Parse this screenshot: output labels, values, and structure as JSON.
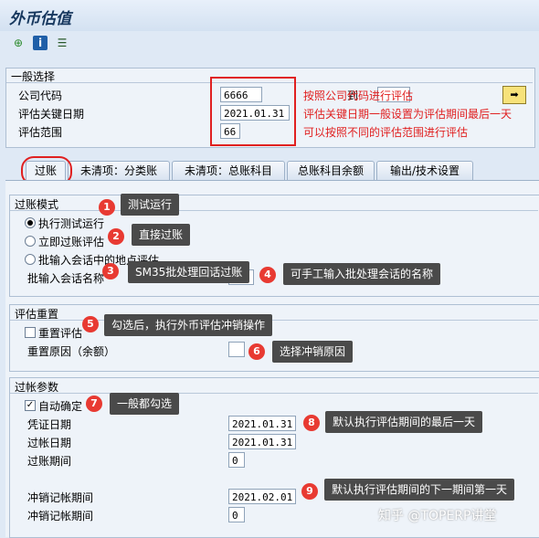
{
  "window": {
    "title": "外币估值"
  },
  "toolbar": {
    "execute_icon": "execute-icon",
    "info_icon": "info-icon",
    "variant_icon": "variant-icon"
  },
  "general": {
    "section_title": "一般选择",
    "company_code_label": "公司代码",
    "company_code": "6666",
    "to_label": "到",
    "key_date_label": "评估关键日期",
    "key_date": "2021.01.31",
    "area_label": "评估范围",
    "area": "66",
    "note1": "按照公司代码进行评估",
    "note2": "评估关键日期一般设置为评估期间最后一天",
    "note3": "可以按照不同的评估范围进行评估"
  },
  "tabs": [
    {
      "label": "过账"
    },
    {
      "label": "未清项：分类账"
    },
    {
      "label": "未清项：总账科目"
    },
    {
      "label": "总账科目余额"
    },
    {
      "label": "输出/技术设置"
    }
  ],
  "posting_mode": {
    "title": "过账模式",
    "opt1": "执行测试运行",
    "opt2": "立即过账评估",
    "opt3": "批输入会话中的地点评估",
    "session_label": "批输入会话名称"
  },
  "reset": {
    "title": "评估重置",
    "reset_label": "重置评估",
    "reason_label": "重置原因（余额）"
  },
  "params": {
    "title": "过帐参数",
    "auto_label": "自动确定",
    "doc_date_label": "凭证日期",
    "doc_date": "2021.01.31",
    "post_date_label": "过帐日期",
    "post_date": "2021.01.31",
    "period_label": "过账期间",
    "period": "0",
    "rev_period_label": "冲销记帐期间",
    "rev_period": "2021.02.01",
    "rev_period2_label": "冲销记帐期间",
    "rev_period2": "0"
  },
  "annotations": [
    {
      "n": "1",
      "text": "测试运行"
    },
    {
      "n": "2",
      "text": "直接过账"
    },
    {
      "n": "3",
      "text": "SM35批处理回话过账"
    },
    {
      "n": "4",
      "text": "可手工输入批处理会话的名称"
    },
    {
      "n": "5",
      "text": "勾选后，执行外币评估冲销操作"
    },
    {
      "n": "6",
      "text": "选择冲销原因"
    },
    {
      "n": "7",
      "text": "一般都勾选"
    },
    {
      "n": "8",
      "text": "默认执行评估期间的最后一天"
    },
    {
      "n": "9",
      "text": "默认执行评估期间的下一期间第一天"
    }
  ],
  "watermark": "知乎 @TOPERP讲堂",
  "colors": {
    "accent_red": "#e02020",
    "badge_red": "#e83a32",
    "tip_bg": "#4a4a4a"
  }
}
